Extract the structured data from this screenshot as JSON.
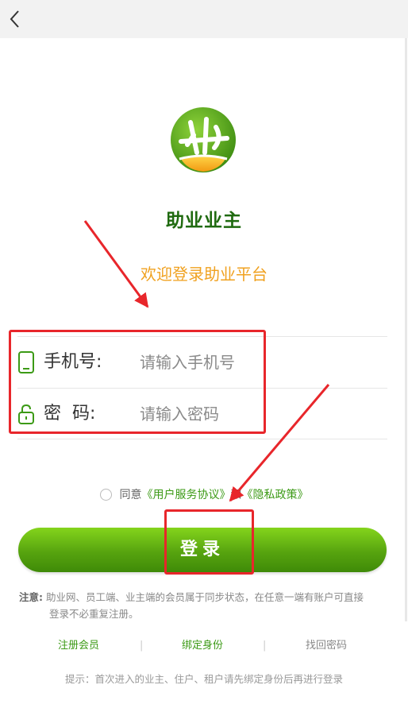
{
  "header": {
    "back_icon": "chevron-left-icon"
  },
  "brand": {
    "logo_icon": "app-logo-icon",
    "name": "助业业主",
    "welcome": "欢迎登录助业平台"
  },
  "form": {
    "phone": {
      "icon": "phone-icon",
      "label": "手机号:",
      "placeholder": "请输入手机号",
      "value": ""
    },
    "password": {
      "icon": "lock-icon",
      "label": "密  码:",
      "placeholder": "请输入密码",
      "value": ""
    }
  },
  "agreement": {
    "prefix": "同意",
    "terms_link": "《用户服务协议》",
    "conjunction": "和",
    "privacy_link": "《隐私政策》",
    "checked": false
  },
  "login_button": "登录",
  "note": {
    "label": "注意:",
    "line1": "助业网、员工端、业主端的会员属于同步状态，在任意一端有账户可直接",
    "line2": "登录不必重复注册。"
  },
  "links": {
    "register": "注册会员",
    "bind": "绑定身份",
    "recover": "找回密码"
  },
  "hint": "提示：首次进入的业主、住户、租户请先绑定身份后再进行登录",
  "colors": {
    "brand_green": "#57a40f",
    "title_green": "#1f6a0f",
    "welcome_orange": "#f0a11f",
    "annotation_red": "#e8262b"
  }
}
